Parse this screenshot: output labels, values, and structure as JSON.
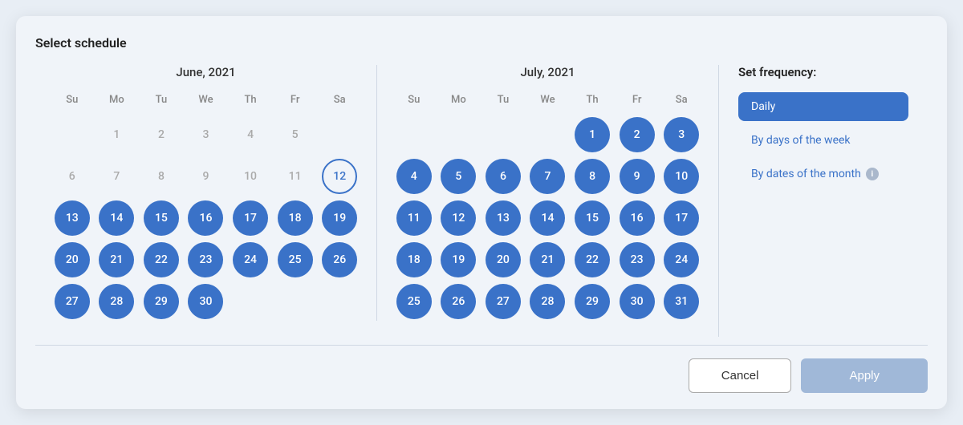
{
  "dialog": {
    "title": "Select schedule",
    "cancel_label": "Cancel",
    "apply_label": "Apply"
  },
  "frequency": {
    "title": "Set frequency:",
    "options": [
      {
        "id": "daily",
        "label": "Daily",
        "active": true
      },
      {
        "id": "by-days",
        "label": "By days of the week",
        "active": false
      },
      {
        "id": "by-dates",
        "label": "By dates of the month",
        "active": false,
        "has_info": true
      }
    ]
  },
  "calendars": [
    {
      "id": "june",
      "title": "June, 2021",
      "day_headers": [
        "Su",
        "Mo",
        "Tu",
        "We",
        "Th",
        "Fr",
        "Sa"
      ],
      "weeks": [
        [
          {
            "num": "",
            "type": "empty"
          },
          {
            "num": "1",
            "type": "inactive"
          },
          {
            "num": "2",
            "type": "inactive"
          },
          {
            "num": "3",
            "type": "inactive"
          },
          {
            "num": "4",
            "type": "inactive"
          },
          {
            "num": "5",
            "type": "inactive"
          },
          {
            "num": "",
            "type": "empty"
          }
        ],
        [
          {
            "num": "6",
            "type": "inactive"
          },
          {
            "num": "7",
            "type": "inactive"
          },
          {
            "num": "8",
            "type": "inactive"
          },
          {
            "num": "9",
            "type": "inactive"
          },
          {
            "num": "10",
            "type": "inactive"
          },
          {
            "num": "11",
            "type": "inactive"
          },
          {
            "num": "12",
            "type": "start"
          }
        ],
        [
          {
            "num": "13",
            "type": "selected"
          },
          {
            "num": "14",
            "type": "selected"
          },
          {
            "num": "15",
            "type": "selected"
          },
          {
            "num": "16",
            "type": "selected"
          },
          {
            "num": "17",
            "type": "selected"
          },
          {
            "num": "18",
            "type": "selected"
          },
          {
            "num": "19",
            "type": "selected"
          }
        ],
        [
          {
            "num": "20",
            "type": "selected"
          },
          {
            "num": "21",
            "type": "selected"
          },
          {
            "num": "22",
            "type": "selected"
          },
          {
            "num": "23",
            "type": "selected"
          },
          {
            "num": "24",
            "type": "selected"
          },
          {
            "num": "25",
            "type": "selected"
          },
          {
            "num": "26",
            "type": "selected"
          }
        ],
        [
          {
            "num": "27",
            "type": "selected"
          },
          {
            "num": "28",
            "type": "selected"
          },
          {
            "num": "29",
            "type": "selected"
          },
          {
            "num": "30",
            "type": "selected"
          },
          {
            "num": "",
            "type": "empty"
          },
          {
            "num": "",
            "type": "empty"
          },
          {
            "num": "",
            "type": "empty"
          }
        ]
      ]
    },
    {
      "id": "july",
      "title": "July, 2021",
      "day_headers": [
        "Su",
        "Mo",
        "Tu",
        "We",
        "Th",
        "Fr",
        "Sa"
      ],
      "weeks": [
        [
          {
            "num": "",
            "type": "empty"
          },
          {
            "num": "",
            "type": "empty"
          },
          {
            "num": "",
            "type": "empty"
          },
          {
            "num": "",
            "type": "empty"
          },
          {
            "num": "1",
            "type": "selected"
          },
          {
            "num": "2",
            "type": "selected"
          },
          {
            "num": "3",
            "type": "selected"
          }
        ],
        [
          {
            "num": "4",
            "type": "selected"
          },
          {
            "num": "5",
            "type": "selected"
          },
          {
            "num": "6",
            "type": "selected"
          },
          {
            "num": "7",
            "type": "selected"
          },
          {
            "num": "8",
            "type": "selected"
          },
          {
            "num": "9",
            "type": "selected"
          },
          {
            "num": "10",
            "type": "selected"
          }
        ],
        [
          {
            "num": "11",
            "type": "selected"
          },
          {
            "num": "12",
            "type": "selected"
          },
          {
            "num": "13",
            "type": "selected"
          },
          {
            "num": "14",
            "type": "selected"
          },
          {
            "num": "15",
            "type": "selected"
          },
          {
            "num": "16",
            "type": "selected"
          },
          {
            "num": "17",
            "type": "selected"
          }
        ],
        [
          {
            "num": "18",
            "type": "selected"
          },
          {
            "num": "19",
            "type": "selected"
          },
          {
            "num": "20",
            "type": "selected"
          },
          {
            "num": "21",
            "type": "selected"
          },
          {
            "num": "22",
            "type": "selected"
          },
          {
            "num": "23",
            "type": "selected"
          },
          {
            "num": "24",
            "type": "selected"
          }
        ],
        [
          {
            "num": "25",
            "type": "selected"
          },
          {
            "num": "26",
            "type": "selected"
          },
          {
            "num": "27",
            "type": "selected"
          },
          {
            "num": "28",
            "type": "selected"
          },
          {
            "num": "29",
            "type": "selected"
          },
          {
            "num": "30",
            "type": "selected"
          },
          {
            "num": "31",
            "type": "selected"
          }
        ]
      ]
    }
  ]
}
